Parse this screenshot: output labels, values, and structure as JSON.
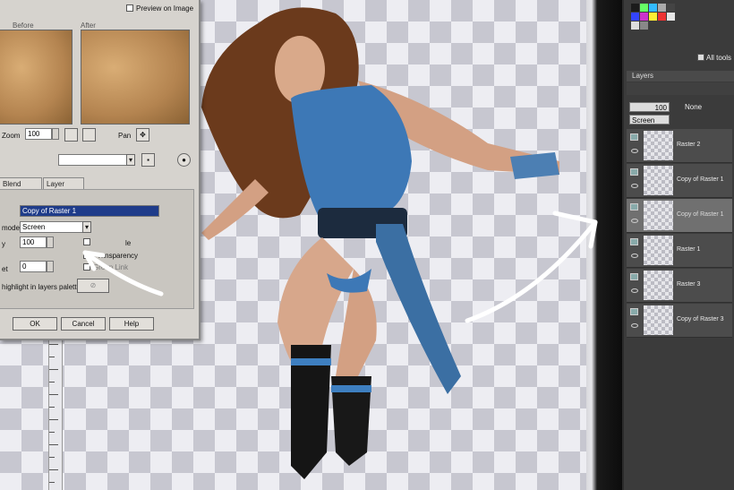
{
  "dialog": {
    "preview_checkbox_label": "Preview on Image",
    "before_label": "Before",
    "after_label": "After",
    "zoom_label": "Zoom",
    "zoom_value": "100",
    "pan_label": "Pan",
    "tabs": [
      "Blend Ranges",
      "Layer Styles"
    ],
    "name_value": "Copy of Raster 1",
    "blend_mode_label": "mode",
    "blend_mode_value": "Screen",
    "opacity_label": "y",
    "opacity_value": "100",
    "group_label": "et",
    "group_value": "0",
    "option_visible": "le",
    "option_transparency": "ransparency",
    "option_group_link": "Group Link",
    "highlight_label": "highlight in layers palette",
    "ok_label": "OK",
    "cancel_label": "Cancel",
    "help_label": "Help"
  },
  "panel": {
    "all_tools_label": "All tools",
    "layers_title": "Layers",
    "opacity_value": "100",
    "mask_label": "None",
    "blend_mode_value": "Screen",
    "layers": [
      {
        "name": "Raster 2"
      },
      {
        "name": "Copy of Raster 1"
      },
      {
        "name": "Copy of Raster 1",
        "selected": true
      },
      {
        "name": "Raster 1"
      },
      {
        "name": "Raster 3"
      },
      {
        "name": "Copy of Raster 3"
      }
    ]
  },
  "colors": {
    "accent_arrow": "#ffffff",
    "selection": "#1f3c8a",
    "dialog_bg": "#d6d3ce",
    "panel_bg": "#3b3b3b"
  }
}
